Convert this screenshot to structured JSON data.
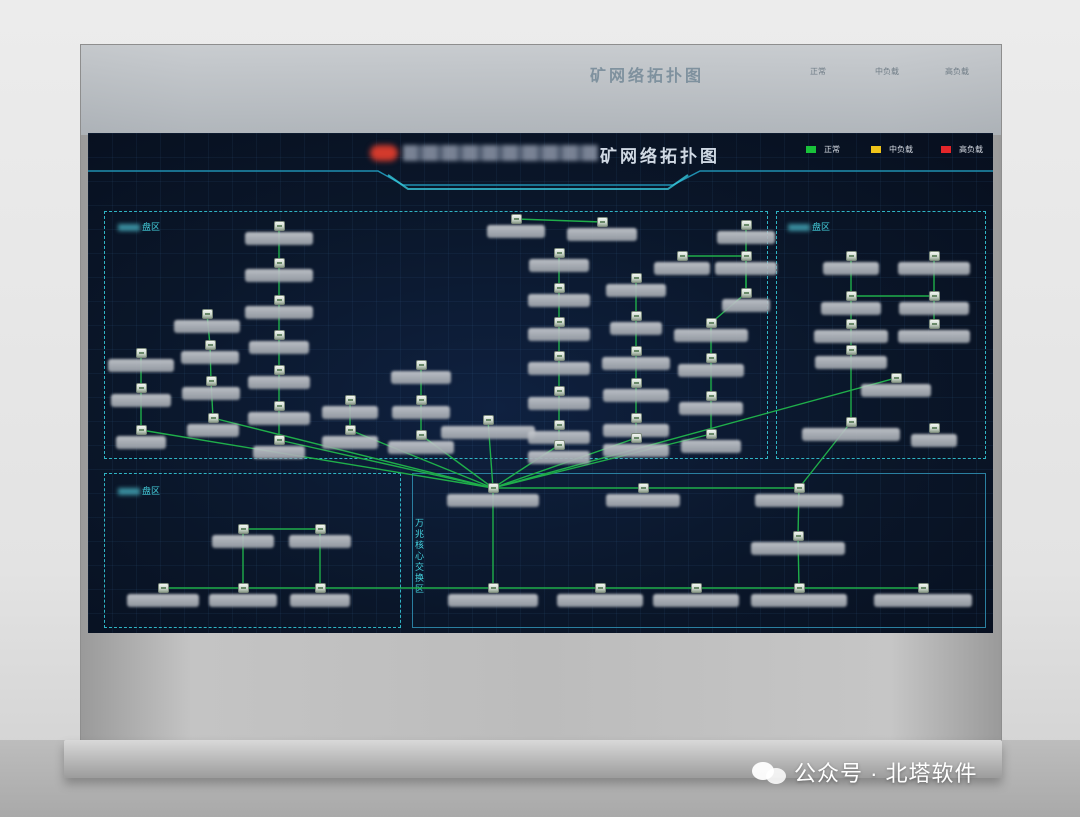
{
  "dashboard": {
    "title": "矿网络拓扑图",
    "legend": [
      {
        "label": "正常",
        "color": "#19c23a"
      },
      {
        "label": "中负载",
        "color": "#f0c419"
      },
      {
        "label": "高负载",
        "color": "#e3262a"
      }
    ],
    "zones": {
      "vertical_label": "万兆核心交换区"
    },
    "zone_suffix": "盘区"
  },
  "watermark": {
    "text": "公众号 · 北塔软件"
  },
  "icons": {
    "switch_node": "network-switch-icon",
    "wechat": "wechat-logo-icon"
  },
  "colors": {
    "screen_bg": "#0a1629",
    "link_green": "#1fae4a",
    "zone_border": "#2fb4c4"
  }
}
